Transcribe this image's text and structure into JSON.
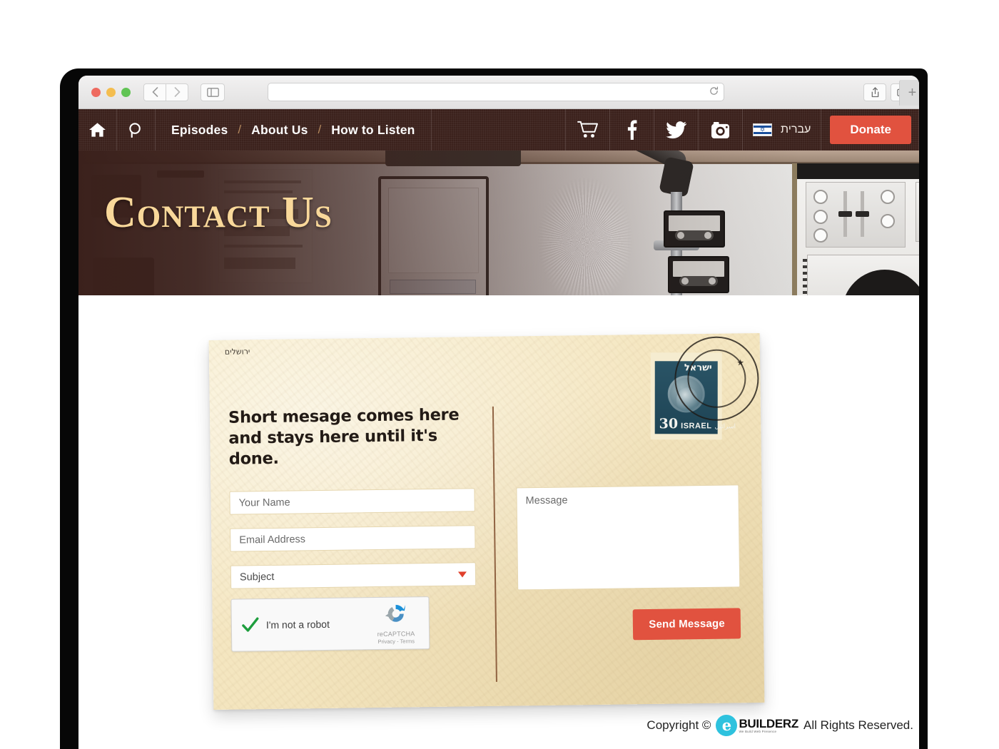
{
  "browser": {
    "url_value": "",
    "url_placeholder": "",
    "back_icon": "chevron-left-icon",
    "forward_icon": "chevron-right-icon",
    "sidebar_icon": "sidebar-toggle-icon",
    "reload_icon": "reload-icon",
    "share_icon": "share-icon",
    "tabs_icon": "tab-overview-icon",
    "new_tab_label": "+"
  },
  "nav": {
    "home_icon": "home-icon",
    "search_icon": "search-icon",
    "links": [
      {
        "label": "Episodes"
      },
      {
        "label": "About Us"
      },
      {
        "label": "How to Listen"
      }
    ],
    "separator": "/",
    "cart_icon": "shopping-cart-icon",
    "facebook_icon": "facebook-icon",
    "twitter_icon": "twitter-icon",
    "instagram_icon": "instagram-icon",
    "language": {
      "flag_icon": "israel-flag-icon",
      "label": "עברית"
    },
    "donate_label": "Donate",
    "accent_red": "#e1523f",
    "bar_color": "#3b211c"
  },
  "hero": {
    "title": "Contact Us",
    "title_color": "#f9d89a"
  },
  "postcard": {
    "heading": "Short mesage comes here and stays here until it's done.",
    "fields": {
      "name_placeholder": "Your Name",
      "email_placeholder": "Email Address",
      "subject_label": "Subject",
      "subject_caret": "dropdown-caret-icon",
      "message_placeholder": "Message"
    },
    "recaptcha": {
      "label": "I'm not a robot",
      "brand": "reCAPTCHA",
      "terms": "Privacy - Terms",
      "checkbox_state": "checked",
      "check_icon": "green-check-icon",
      "logo_icon": "recaptcha-logo-icon"
    },
    "send_label": "Send Message",
    "stamp": {
      "country_hebrew": "ישראל",
      "value": "30",
      "country_latin": "ISRAEL",
      "country_arabic": "اسرائيل",
      "postmark_text": "ירושלים",
      "postmark_star": "★"
    }
  },
  "footer": {
    "copyright_prefix": "Copyright ©",
    "brand_mark": "e",
    "brand_name": "BUILDERZ",
    "brand_tagline": "We Build Web Presence",
    "copyright_suffix": "All Rights Reserved."
  }
}
